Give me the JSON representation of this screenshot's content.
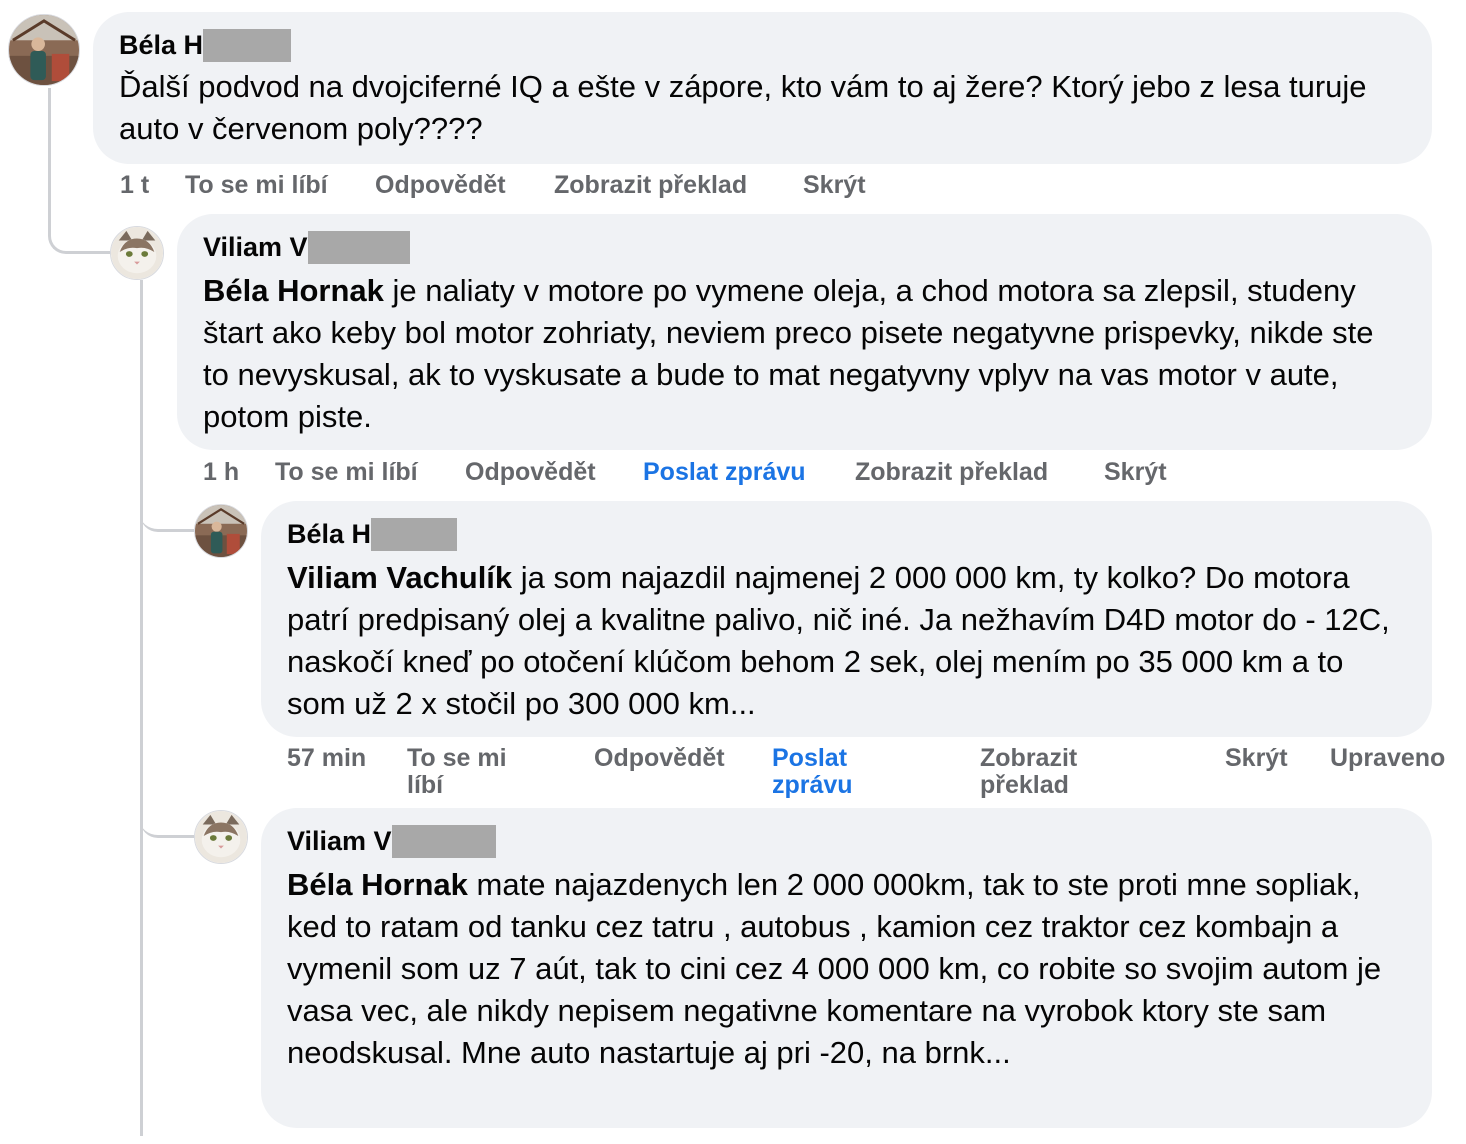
{
  "comments": [
    {
      "author_visible": "Béla H",
      "mention": "",
      "text": "Ďalší podvod na dvojciferné IQ a ešte v zápore, kto vám to aj žere? Ktorý jebo z lesa turuje auto v červenom poly????",
      "actions": {
        "time": "1 t",
        "like": "To se mi líbí",
        "reply": "Odpovědět",
        "translate": "Zobrazit překlad",
        "hide": "Skrýt"
      }
    },
    {
      "author_visible": "Viliam V",
      "mention": "Béla Hornak",
      "text": " je naliaty v motore po vymene oleja, a chod motora sa zlepsil, studeny štart ako keby bol motor zohriaty, neviem preco pisete negatyvne prispevky, nikde ste to nevyskusal, ak to vyskusate a bude to mat negatyvny vplyv na vas motor v aute, potom piste.",
      "actions": {
        "time": "1 h",
        "like": "To se mi líbí",
        "reply": "Odpovědět",
        "message": "Poslat zprávu",
        "translate": "Zobrazit překlad",
        "hide": "Skrýt"
      }
    },
    {
      "author_visible": "Béla H",
      "mention": "Viliam Vachulík",
      "text": " ja som najazdil najmenej 2 000 000 km, ty kolko? Do motora patrí predpisaný olej a kvalitne palivo, nič iné. Ja nežhavím D4D motor do - 12C, naskočí kneď po otočení klúčom behom 2 sek, olej mením po 35 000 km a to som už 2 x stočil po 300 000 km...",
      "actions": {
        "time": "57 min",
        "like": "To se mi líbí",
        "reply": "Odpovědět",
        "message": "Poslat zprávu",
        "translate": "Zobrazit překlad",
        "hide": "Skrýt",
        "edited": "Upraveno"
      }
    },
    {
      "author_visible": "Viliam V",
      "mention": "Béla Hornak",
      "text": " mate najazdenych len 2 000 000km, tak to ste proti mne sopliak, ked to ratam od tanku cez tatru , autobus , kamion cez traktor cez kombajn a vymenil som uz 7 aút, tak to cini cez 4 000 000 km, co robite so svojim autom je vasa vec, ale nikdy nepisem negativne komentare na vyrobok ktory ste sam neodskusal. Mne auto nastartuje aj pri -20, na brnk..."
    }
  ],
  "colors": {
    "bubble": "#f0f2f5",
    "action_text": "#65676b",
    "link_blue": "#1b74e4",
    "thread_line": "#ced0d4",
    "redaction": "#a8a8a8"
  },
  "icons": {
    "avatar_bela": "person-outdoors-avatar",
    "avatar_viliam": "cat-avatar"
  }
}
